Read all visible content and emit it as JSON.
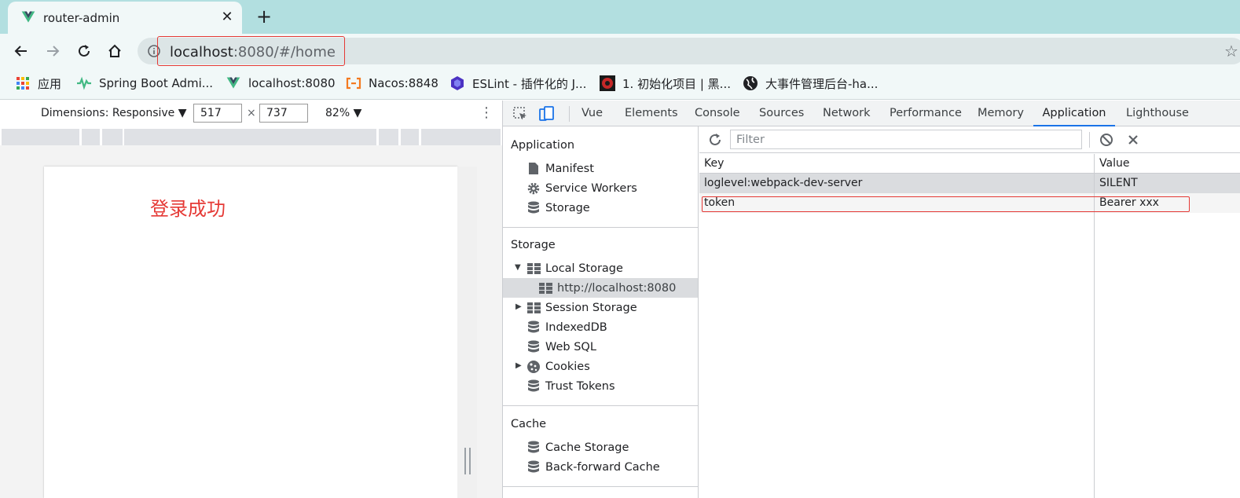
{
  "tab": {
    "title": "router-admin",
    "favicon": "vue-logo-icon",
    "close": "✕",
    "new_tab": "+"
  },
  "toolbar": {
    "back": "back-arrow-icon",
    "forward": "forward-arrow-icon",
    "reload": "reload-icon",
    "home": "home-icon",
    "url_host": "localhost",
    "url_rest": ":8080/#/home"
  },
  "bookmarks": [
    {
      "label": "应用",
      "icon": "apps-grid-icon"
    },
    {
      "label": "Spring Boot Admi...",
      "icon": "spring-boot-admin-icon"
    },
    {
      "label": "localhost:8080",
      "icon": "vue-logo-icon"
    },
    {
      "label": "Nacos:8848",
      "icon": "nacos-icon"
    },
    {
      "label": "ESLint - 插件化的 J...",
      "icon": "eslint-icon"
    },
    {
      "label": "1. 初始化项目 | 黑...",
      "icon": "heima-icon"
    },
    {
      "label": "大事件管理后台-ha...",
      "icon": "globe-icon"
    }
  ],
  "device_toolbar": {
    "dimensions_label": "Dimensions: Responsive ▼",
    "width": "517",
    "height": "737",
    "times": "×",
    "zoom": "82% ▼"
  },
  "page": {
    "message": "登录成功"
  },
  "devtools": {
    "tabs": [
      "Vue",
      "Elements",
      "Console",
      "Sources",
      "Network",
      "Performance",
      "Memory",
      "Application",
      "Lighthouse"
    ],
    "active_tab": "Application",
    "sidebar": {
      "application_title": "Application",
      "application_items": [
        "Manifest",
        "Service Workers",
        "Storage"
      ],
      "storage_title": "Storage",
      "local_storage": "Local Storage",
      "local_storage_origin": "http://localhost:8080",
      "session_storage": "Session Storage",
      "indexeddb": "IndexedDB",
      "websql": "Web SQL",
      "cookies": "Cookies",
      "trust_tokens": "Trust Tokens",
      "cache_title": "Cache",
      "cache_storage": "Cache Storage",
      "back_forward_cache": "Back-forward Cache"
    },
    "filter_placeholder": "Filter",
    "table": {
      "columns": [
        "Key",
        "Value"
      ],
      "rows": [
        {
          "key": "loglevel:webpack-dev-server",
          "value": "SILENT"
        },
        {
          "key": "token",
          "value": "Bearer xxx"
        }
      ]
    }
  },
  "colors": {
    "accent": "#1a73e8",
    "highlight_red": "#e53935",
    "tab_strip": "#b2dfe0"
  }
}
